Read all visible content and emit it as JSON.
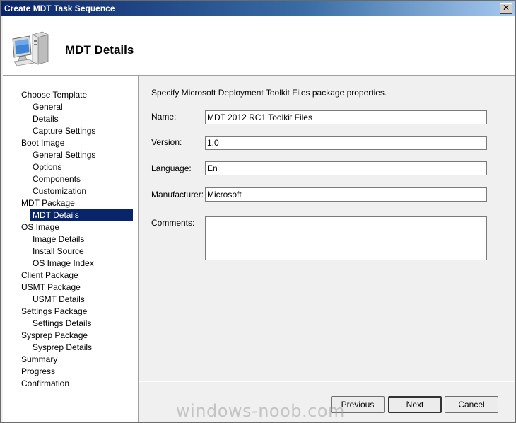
{
  "window": {
    "title": "Create MDT Task Sequence",
    "close_label": "✕"
  },
  "header": {
    "icon": "computer-icon",
    "heading": "MDT Details"
  },
  "sidebar": {
    "items": [
      {
        "label": "Choose Template",
        "level": 0
      },
      {
        "label": "General",
        "level": 1
      },
      {
        "label": "Details",
        "level": 1
      },
      {
        "label": "Capture Settings",
        "level": 1
      },
      {
        "label": "Boot Image",
        "level": 0
      },
      {
        "label": "General Settings",
        "level": 1
      },
      {
        "label": "Options",
        "level": 1
      },
      {
        "label": "Components",
        "level": 1
      },
      {
        "label": "Customization",
        "level": 1
      },
      {
        "label": "MDT Package",
        "level": 0
      },
      {
        "label": "MDT Details",
        "level": 1,
        "selected": true
      },
      {
        "label": "OS Image",
        "level": 0
      },
      {
        "label": "Image Details",
        "level": 1
      },
      {
        "label": "Install Source",
        "level": 1
      },
      {
        "label": "OS Image Index",
        "level": 1
      },
      {
        "label": "Client Package",
        "level": 0
      },
      {
        "label": "USMT Package",
        "level": 0
      },
      {
        "label": "USMT Details",
        "level": 1
      },
      {
        "label": "Settings Package",
        "level": 0
      },
      {
        "label": "Settings Details",
        "level": 1
      },
      {
        "label": "Sysprep Package",
        "level": 0
      },
      {
        "label": "Sysprep Details",
        "level": 1
      },
      {
        "label": "Summary",
        "level": 0
      },
      {
        "label": "Progress",
        "level": 0
      },
      {
        "label": "Confirmation",
        "level": 0
      }
    ]
  },
  "form": {
    "instruction": "Specify Microsoft Deployment Toolkit Files package properties.",
    "name": {
      "label": "Name:",
      "value": "MDT 2012 RC1 Toolkit Files"
    },
    "version": {
      "label": "Version:",
      "value": "1.0"
    },
    "language": {
      "label": "Language:",
      "value": "En"
    },
    "manufacturer": {
      "label": "Manufacturer:",
      "value": "Microsoft"
    },
    "comments": {
      "label": "Comments:",
      "value": ""
    }
  },
  "buttons": {
    "previous": "Previous",
    "next": "Next",
    "cancel": "Cancel"
  },
  "watermark": "windows-noob.com",
  "colors": {
    "selection": "#0a246a",
    "title_bar": "#0a246a"
  }
}
